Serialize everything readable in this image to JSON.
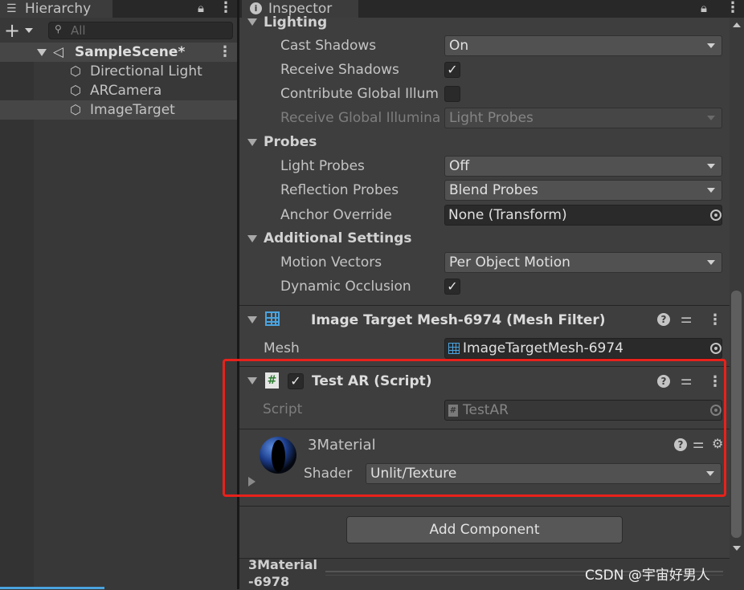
{
  "hierarchy": {
    "tab_label": "Hierarchy",
    "search_placeholder": "All",
    "scene_name": "SampleScene*",
    "items": [
      {
        "label": "Directional Light"
      },
      {
        "label": "ARCamera"
      },
      {
        "label": "ImageTarget"
      }
    ]
  },
  "inspector": {
    "tab_label": "Inspector",
    "lighting": {
      "header": "Lighting",
      "cast_shadows_label": "Cast Shadows",
      "cast_shadows_value": "On",
      "receive_shadows_label": "Receive Shadows",
      "receive_shadows_checked": true,
      "contribute_gi_label": "Contribute Global Illum",
      "receive_gi_label": "Receive Global Illumina",
      "receive_gi_value": "Light Probes"
    },
    "probes": {
      "header": "Probes",
      "light_probes_label": "Light Probes",
      "light_probes_value": "Off",
      "reflection_probes_label": "Reflection Probes",
      "reflection_probes_value": "Blend Probes",
      "anchor_override_label": "Anchor Override",
      "anchor_override_value": "None (Transform)"
    },
    "additional": {
      "header": "Additional Settings",
      "motion_vectors_label": "Motion Vectors",
      "motion_vectors_value": "Per Object Motion",
      "dynamic_occlusion_label": "Dynamic Occlusion",
      "dynamic_occlusion_checked": true
    },
    "mesh_filter": {
      "title": "Image Target Mesh-6974 (Mesh Filter)",
      "mesh_label": "Mesh",
      "mesh_value": "ImageTargetMesh-6974"
    },
    "script_component": {
      "title": "Test AR (Script)",
      "script_label": "Script",
      "script_value": "TestAR"
    },
    "material": {
      "name": "3Material",
      "shader_label": "Shader",
      "shader_value": "Unlit/Texture"
    },
    "add_component_label": "Add Component",
    "footer_material_line1": "3Material",
    "footer_material_line2": "-6978"
  },
  "watermark": "CSDN @宇宙好男人",
  "colors": {
    "highlight_box": "#e8211b",
    "panel_bg": "#3e3e3e",
    "accent_blue": "#4aa3df"
  }
}
